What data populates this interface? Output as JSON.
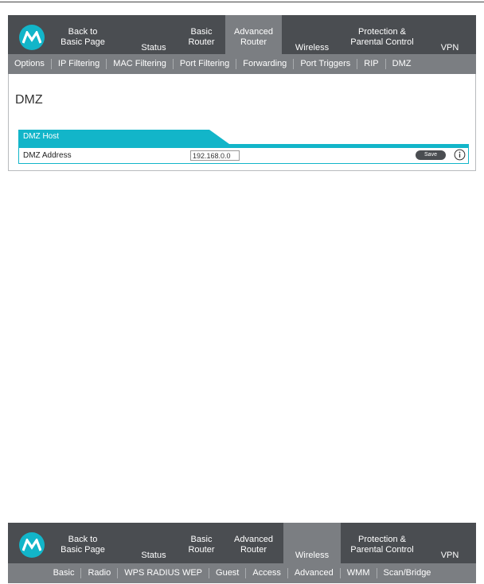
{
  "nav": {
    "back_line1": "Back to",
    "back_line2": "Basic Page",
    "status": "Status",
    "basic_router_line1": "Basic",
    "basic_router_line2": "Router",
    "advanced_router_line1": "Advanced",
    "advanced_router_line2": "Router",
    "wireless": "Wireless",
    "protection_line1": "Protection &",
    "protection_line2": "Parental Control",
    "vpn": "VPN"
  },
  "subnav_top": [
    "Options",
    "IP Filtering",
    "MAC Filtering",
    "Port Filtering",
    "Forwarding",
    "Port Triggers",
    "RIP",
    "DMZ"
  ],
  "page_title": "DMZ",
  "dmz_host": {
    "section_label": "DMZ Host",
    "address_label": "DMZ Address",
    "address_value": "192.168.0.0",
    "save_label": "Save"
  },
  "subnav_bottom": [
    "Basic",
    "Radio",
    "WPS RADIUS WEP",
    "Guest",
    "Access",
    "Advanced",
    "WMM",
    "Scan/Bridge"
  ],
  "colors": {
    "accent": "#12b5c9",
    "nav_bg": "#4a4d51",
    "nav_active": "#7b7e82"
  },
  "icons": {
    "logo": "motorola-logo-icon",
    "info": "info-icon"
  }
}
